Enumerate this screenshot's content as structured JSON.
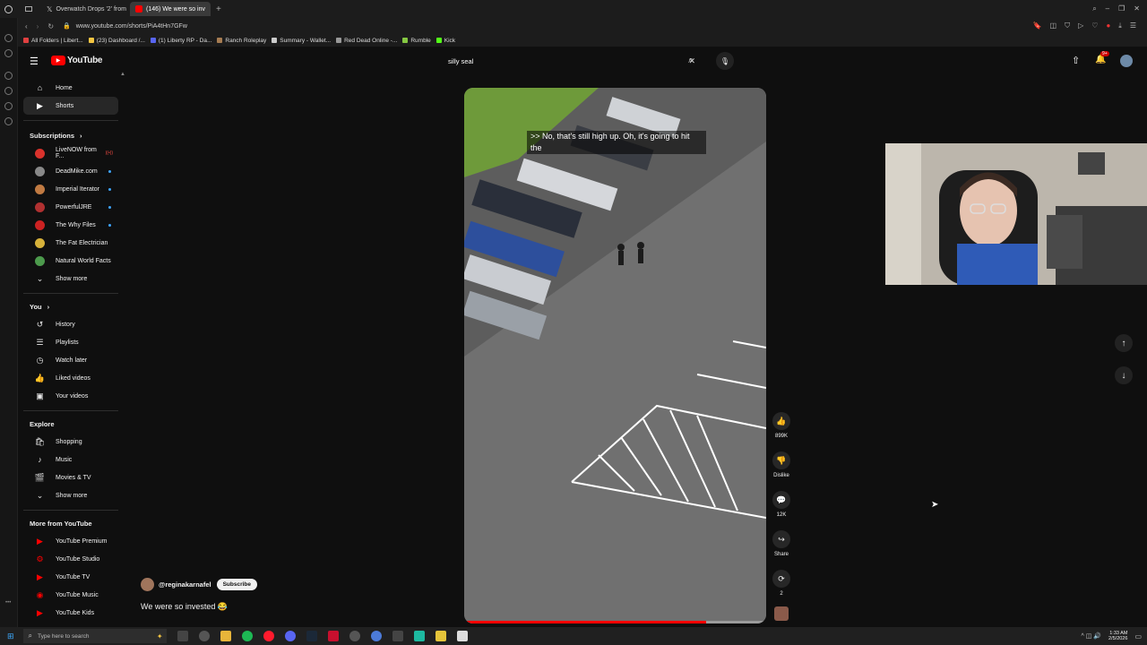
{
  "browser": {
    "tabs": [
      {
        "label": "Overwatch Drops '2' from",
        "icon": "x-icon",
        "active": false
      },
      {
        "label": "(146) We were so inv",
        "icon": "youtube-icon",
        "active": true
      }
    ],
    "url": "www.youtube.com/shorts/PiA4tHn7GFw",
    "bookmarks": [
      {
        "label": "All Folders | Libert...",
        "color": "#e04040"
      },
      {
        "label": "(23) Dashboard /...",
        "color": "#f4c542"
      },
      {
        "label": "(1) Liberty RP - Da...",
        "color": "#5865f2"
      },
      {
        "label": "Ranch Roleplay",
        "color": "#a67c52"
      },
      {
        "label": "Summary - Wallet...",
        "color": "#cccccc"
      },
      {
        "label": "Red Dead Online -...",
        "color": "#999999"
      },
      {
        "label": "Rumble",
        "color": "#85c742"
      },
      {
        "label": "Kick",
        "color": "#53fc18"
      }
    ]
  },
  "header": {
    "logo_text": "YouTube",
    "search_value": "silly seal",
    "notif_badge": "9+"
  },
  "sidebar": {
    "main": [
      {
        "label": "Home",
        "icon": "home-icon",
        "glyph": "⌂",
        "active": false
      },
      {
        "label": "Shorts",
        "icon": "shorts-icon",
        "glyph": "▶",
        "active": true
      }
    ],
    "subscriptions_title": "Subscriptions",
    "subscriptions": [
      {
        "label": "LiveNOW from F...",
        "color": "#d9322c",
        "indicator": "live"
      },
      {
        "label": "DeadMike.com",
        "color": "#888888",
        "indicator": "dot"
      },
      {
        "label": "Imperial Iterator",
        "color": "#c07a42",
        "indicator": "dot"
      },
      {
        "label": "PowerfulJRE",
        "color": "#b03030",
        "indicator": "dot"
      },
      {
        "label": "The Why Files",
        "color": "#cc2222",
        "indicator": "dot"
      },
      {
        "label": "The Fat Electrician",
        "color": "#d6b13a",
        "indicator": "none"
      },
      {
        "label": "Natural World Facts",
        "color": "#4c9a4c",
        "indicator": "none"
      }
    ],
    "show_more": "Show more",
    "you_title": "You",
    "you": [
      {
        "label": "History",
        "icon": "history-icon",
        "glyph": "↺"
      },
      {
        "label": "Playlists",
        "icon": "playlists-icon",
        "glyph": "☰"
      },
      {
        "label": "Watch later",
        "icon": "clock-icon",
        "glyph": "◷"
      },
      {
        "label": "Liked videos",
        "icon": "thumbs-up-icon",
        "glyph": "👍"
      },
      {
        "label": "Your videos",
        "icon": "video-icon",
        "glyph": "▣"
      }
    ],
    "explore_title": "Explore",
    "explore": [
      {
        "label": "Shopping",
        "icon": "shopping-bag-icon",
        "glyph": "🛍"
      },
      {
        "label": "Music",
        "icon": "music-icon",
        "glyph": "♪"
      },
      {
        "label": "Movies & TV",
        "icon": "clapper-icon",
        "glyph": "🎬"
      }
    ],
    "explore_show_more": "Show more",
    "more_title": "More from YouTube",
    "more": [
      {
        "label": "YouTube Premium",
        "color": "#ff0000"
      },
      {
        "label": "YouTube Studio",
        "color": "#ff0000"
      },
      {
        "label": "YouTube TV",
        "color": "#ff0000"
      },
      {
        "label": "YouTube Music",
        "color": "#ff0000"
      },
      {
        "label": "YouTube Kids",
        "color": "#ff0000"
      }
    ]
  },
  "short": {
    "caption": ">> No, that's still high up. Oh, it's going to hit the",
    "channel": "@reginakarnafel",
    "subscribe_label": "Subscribe",
    "title": "We were so invested 😂",
    "progress": 0.8,
    "actions": [
      {
        "label": "899K",
        "icon": "thumbs-up-icon",
        "glyph": "👍"
      },
      {
        "label": "Dislike",
        "icon": "thumbs-down-icon",
        "glyph": "👎"
      },
      {
        "label": "12K",
        "icon": "comment-icon",
        "glyph": "💬"
      },
      {
        "label": "Share",
        "icon": "share-icon",
        "glyph": "↪"
      },
      {
        "label": "2",
        "icon": "remix-icon",
        "glyph": "⟳"
      }
    ]
  },
  "taskbar": {
    "search_placeholder": "Type here to search",
    "time": "1:33 AM",
    "date": "2/5/2026"
  },
  "colors": {
    "accent": "#ff0000",
    "link_blue": "#3ea6ff"
  }
}
